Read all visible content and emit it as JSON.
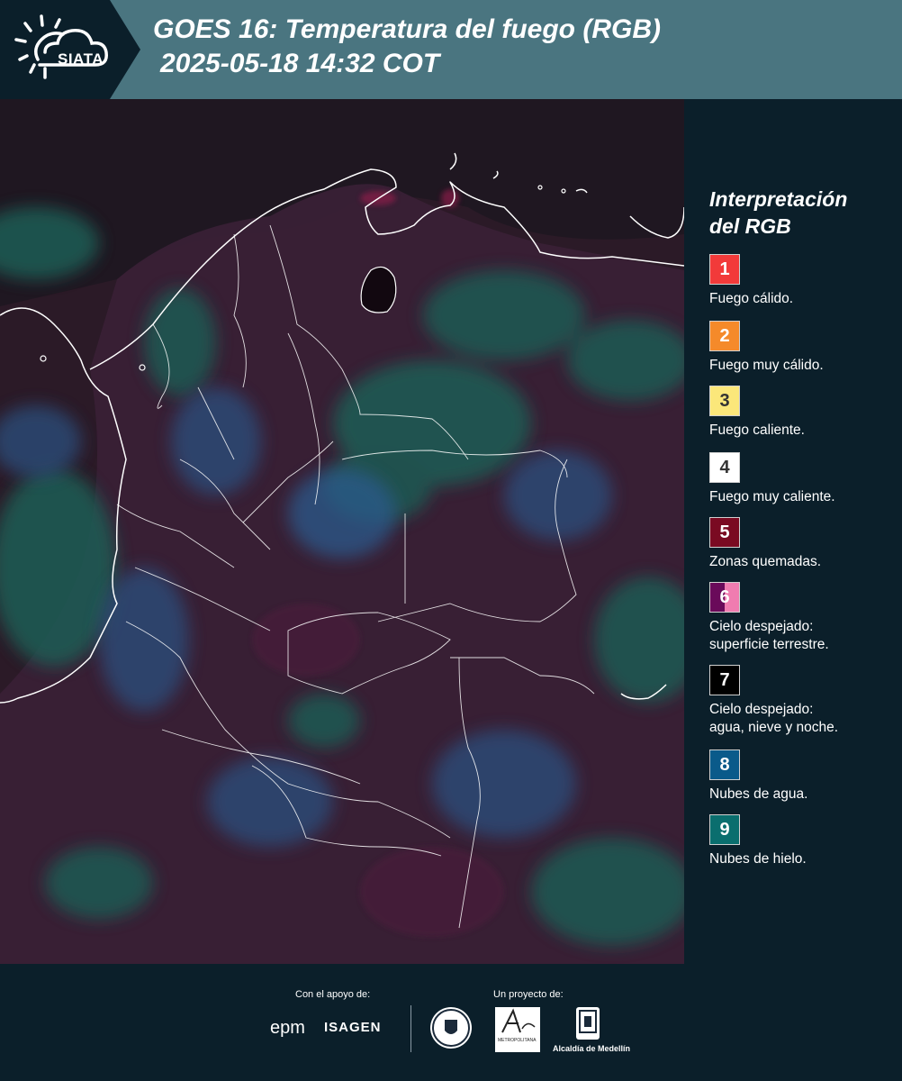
{
  "header": {
    "logo_text": "SIATA",
    "title_line1": "GOES 16: Temperatura del fuego (RGB)",
    "title_line2": "2025-05-18 14:32 COT"
  },
  "legend": {
    "title_line1": "Interpretación",
    "title_line2": "del RGB",
    "items": [
      {
        "number": "1",
        "label_line1": "Fuego cálido.",
        "label_line2": "",
        "color": "#f23a3a",
        "text_color": "#ffffff"
      },
      {
        "number": "2",
        "label_line1": "Fuego muy cálido.",
        "label_line2": "",
        "color": "#f58a2a",
        "text_color": "#ffffff"
      },
      {
        "number": "3",
        "label_line1": "Fuego caliente.",
        "label_line2": "",
        "color": "#fbe77a",
        "text_color": "#333333"
      },
      {
        "number": "4",
        "label_line1": "Fuego muy caliente.",
        "label_line2": "",
        "color": "#ffffff",
        "text_color": "#333333"
      },
      {
        "number": "5",
        "label_line1": "Zonas quemadas.",
        "label_line2": "",
        "color": "#7a0a22",
        "text_color": "#ffffff"
      },
      {
        "number": "6",
        "label_line1": "Cielo despejado:",
        "label_line2": "superficie terrestre.",
        "color": "#6a0a5a",
        "color2": "#f07cb0",
        "text_color": "#ffffff"
      },
      {
        "number": "7",
        "label_line1": "Cielo despejado:",
        "label_line2": "agua, nieve y noche.",
        "color": "#000000",
        "text_color": "#ffffff"
      },
      {
        "number": "8",
        "label_line1": "Nubes de agua.",
        "label_line2": "",
        "color": "#0a5a8a",
        "text_color": "#ffffff"
      },
      {
        "number": "9",
        "label_line1": "Nubes de hielo.",
        "label_line2": "",
        "color": "#0a6e6e",
        "text_color": "#ffffff"
      }
    ]
  },
  "footer": {
    "support_label": "Con el apoyo de:",
    "project_label": "Un proyecto de:",
    "sponsor1": "epm",
    "sponsor2": "ISAGEN",
    "partner_area": "METROPOLITANA",
    "partner_medellin": "Alcaldía de Medellín"
  }
}
